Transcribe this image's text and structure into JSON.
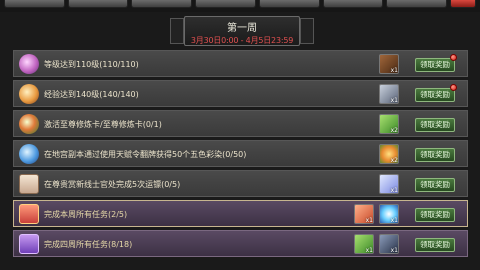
{
  "header": {
    "week": "第一周",
    "dates": "3月30日0:00 - 4月5日23:59"
  },
  "colors": {
    "date_red": "#e05050",
    "claim_green": "#3a6a32",
    "notify_red": "#d01a10"
  },
  "tasks": [
    {
      "label": "等级达到110级(110/110)",
      "icon": "pink-gem-icon",
      "rewards": [
        {
          "name": "brown-pack-icon",
          "count": "x1"
        }
      ],
      "claim": "领取奖励",
      "notify": true
    },
    {
      "label": "经验达到140级(140/140)",
      "icon": "orange-gem-icon",
      "rewards": [
        {
          "name": "silver-box-icon",
          "count": "x1"
        }
      ],
      "claim": "领取奖励",
      "notify": true
    },
    {
      "label": "激活至尊修炼卡/至尊修炼卡(0/1)",
      "icon": "flower-gem-icon",
      "rewards": [
        {
          "name": "green-box-icon",
          "count": "x2"
        }
      ],
      "claim": "领取奖励",
      "notify": false
    },
    {
      "label": "在地宫副本通过使用天赋令翻牌获得50个五色彩染(0/50)",
      "icon": "blue-orb-icon",
      "rewards": [
        {
          "name": "flower-item-icon",
          "count": "x2"
        }
      ],
      "claim": "领取奖励",
      "notify": false
    },
    {
      "label": "在尊贵赏新线士官处完成5次运镖(0/5)",
      "icon": "scroll-icon",
      "rewards": [
        {
          "name": "crystal-item-icon",
          "count": "x1"
        }
      ],
      "claim": "领取奖励",
      "notify": false
    },
    {
      "label": "完成本周所有任务(2/5)",
      "icon": "gift-icon",
      "rewards": [
        {
          "name": "red-scroll-icon",
          "count": "x1"
        },
        {
          "name": "cyan-orb-icon",
          "count": "x1"
        }
      ],
      "claim": "领取奖励",
      "notify": false
    },
    {
      "label": "完成四周所有任务(8/18)",
      "icon": "purple-gift-icon",
      "rewards": [
        {
          "name": "green-fan-icon",
          "count": "x1"
        },
        {
          "name": "dark-mask-icon",
          "count": "x1"
        }
      ],
      "claim": "领取奖励",
      "notify": false
    }
  ]
}
